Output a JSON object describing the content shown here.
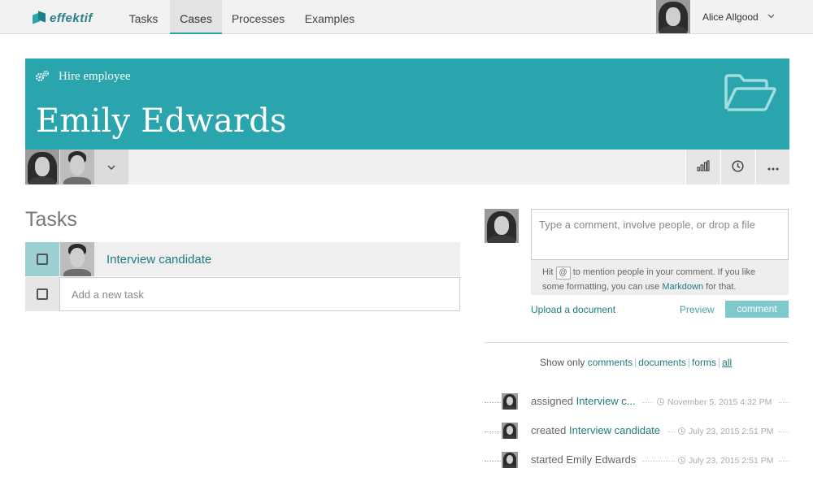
{
  "app": {
    "logo_text": "effektif"
  },
  "nav": {
    "tabs": [
      "Tasks",
      "Cases",
      "Processes",
      "Examples"
    ],
    "active_tab": "Cases",
    "user_name": "Alice Allgood"
  },
  "case": {
    "process_name": "Hire employee",
    "title": "Emily Edwards",
    "accent_color": "#2aa5ad"
  },
  "tasks": {
    "heading": "Tasks",
    "items": [
      {
        "label": "Interview candidate",
        "checked": false
      }
    ],
    "new_task_placeholder": "Add a new task"
  },
  "comments": {
    "placeholder": "Type a comment, involve people, or drop a file",
    "hint_prefix": "Hit",
    "hint_key": "@",
    "hint_middle": "to mention people in your comment. If you like some formatting, you can use",
    "hint_link": "Markdown",
    "hint_suffix": "for that.",
    "upload_label": "Upload a document",
    "preview_label": "Preview",
    "submit_label": "comment"
  },
  "filter": {
    "prefix": "Show only",
    "options": [
      "comments",
      "documents",
      "forms",
      "all"
    ],
    "active": "all"
  },
  "activity": [
    {
      "verb": "assigned",
      "object": "Interview c...",
      "time": "November 5, 2015 4:32 PM"
    },
    {
      "verb": "created",
      "object": "Interview candidate",
      "time": "July 23, 2015 2:51 PM"
    },
    {
      "verb": "started",
      "object": "Emily Edwards",
      "time": "July 23, 2015 2:51 PM"
    }
  ]
}
